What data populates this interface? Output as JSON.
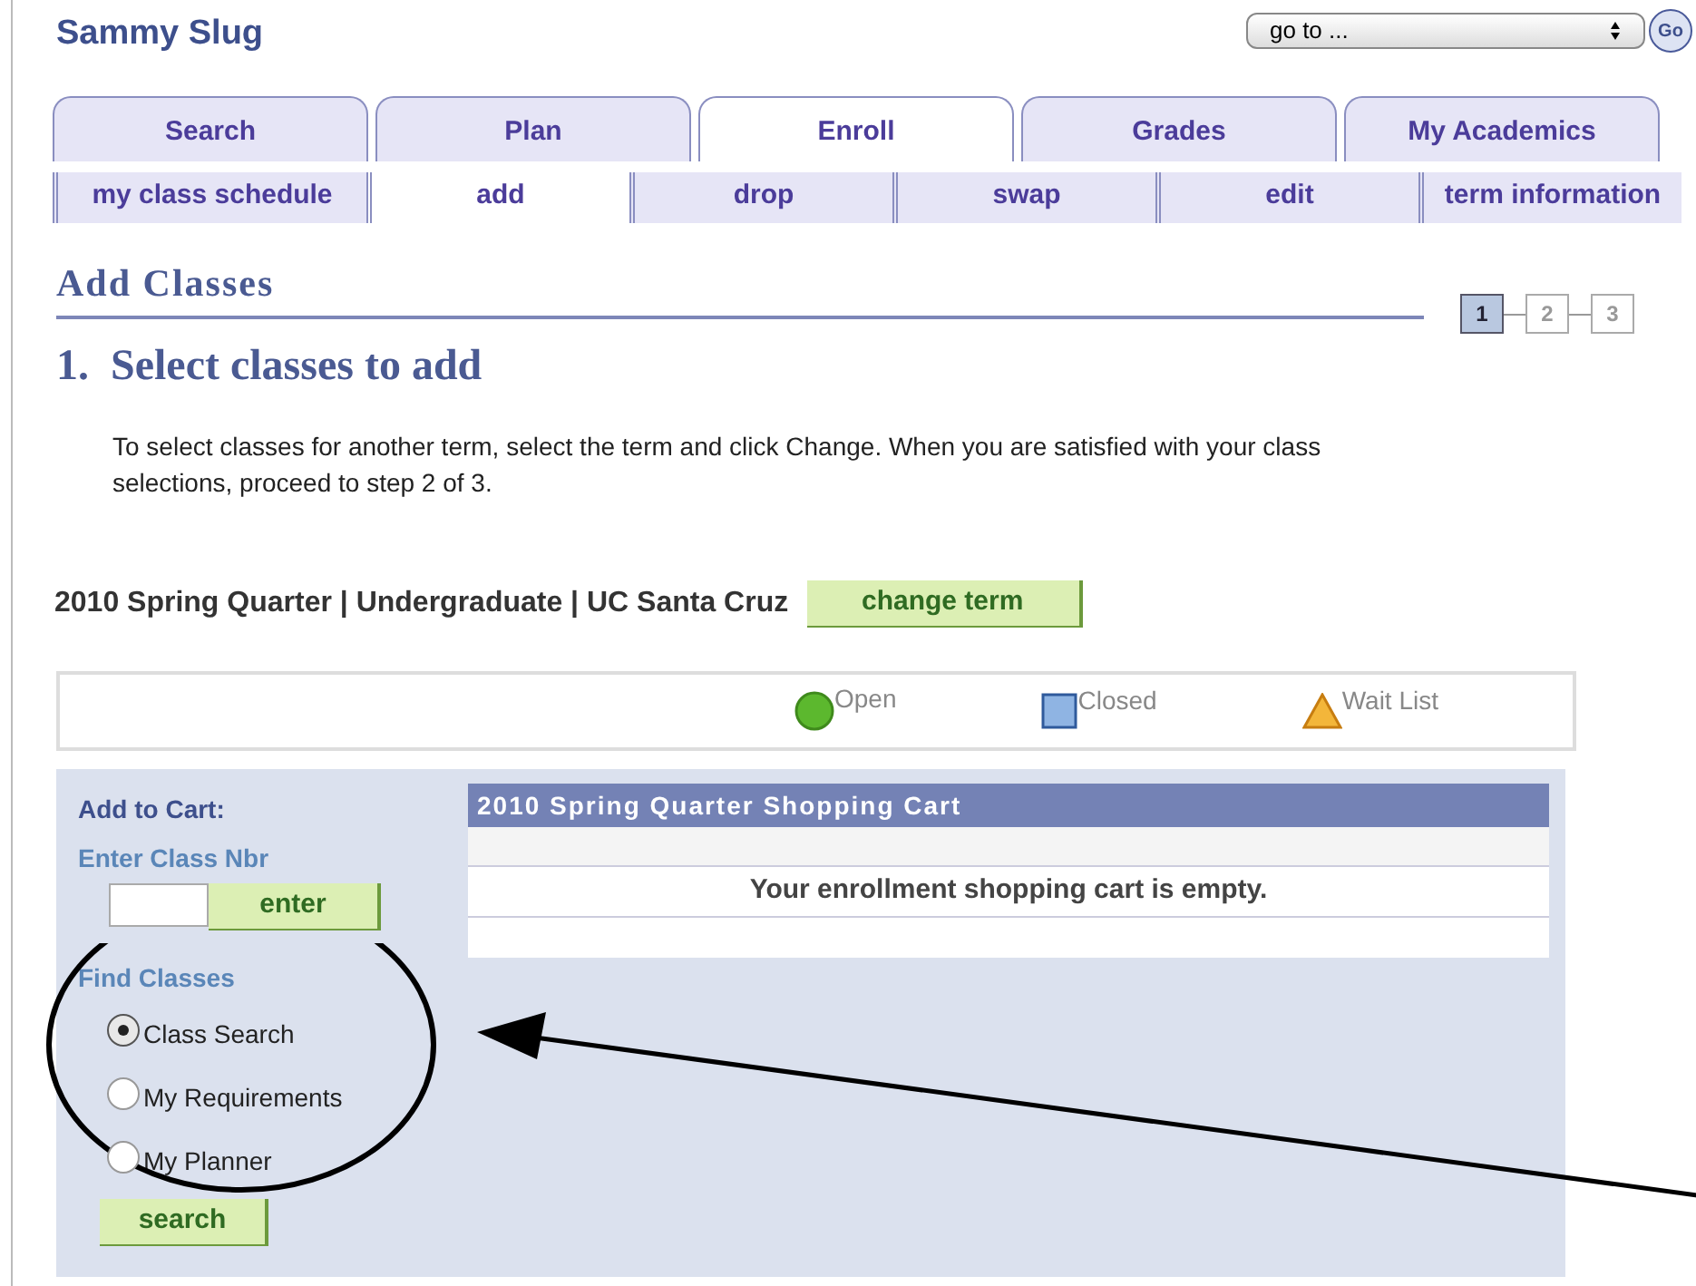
{
  "header": {
    "title": "Sammy Slug",
    "goto": {
      "value": "go to ..."
    },
    "go_button": "Go"
  },
  "tabs": [
    {
      "label": "Search",
      "selected": false
    },
    {
      "label": "Plan",
      "selected": false
    },
    {
      "label": "Enroll",
      "selected": true
    },
    {
      "label": "Grades",
      "selected": false
    },
    {
      "label": "My Academics",
      "selected": false
    }
  ],
  "subtabs": [
    {
      "label": "my class schedule",
      "selected": false
    },
    {
      "label": "add",
      "selected": true
    },
    {
      "label": "drop",
      "selected": false
    },
    {
      "label": "swap",
      "selected": false
    },
    {
      "label": "edit",
      "selected": false
    },
    {
      "label": "term information",
      "selected": false
    }
  ],
  "page_title": "Add Classes",
  "steps": [
    {
      "label": "1",
      "selected": true
    },
    {
      "label": "2",
      "selected": false
    },
    {
      "label": "3",
      "selected": false
    }
  ],
  "step_heading": "1.  Select classes to add",
  "instructions": "To select classes for another term, select the term and click Change.  When you are satisfied with your class selections, proceed to step 2 of 3.",
  "term": {
    "label": "2010 Spring Quarter | Undergraduate | UC Santa Cruz",
    "button": "change term"
  },
  "legend": [
    {
      "kind": "circle",
      "label": "Open",
      "color": "#5cb82e"
    },
    {
      "kind": "square",
      "label": "Closed",
      "color": "#8fb4e3"
    },
    {
      "kind": "triangle",
      "label": "Wait List",
      "color": "#f3b63a"
    }
  ],
  "add_to_cart": {
    "title": "Add to Cart:",
    "class_nbr_label": "Enter Class Nbr",
    "enter_button": "enter",
    "find_label": "Find Classes",
    "options": [
      {
        "label": "Class Search",
        "selected": true
      },
      {
        "label": "My Requirements",
        "selected": false
      },
      {
        "label": "My Planner",
        "selected": false
      }
    ],
    "search_button": "search"
  },
  "cart": {
    "title": "2010 Spring Quarter Shopping Cart",
    "message": "Your enrollment shopping cart is empty."
  }
}
